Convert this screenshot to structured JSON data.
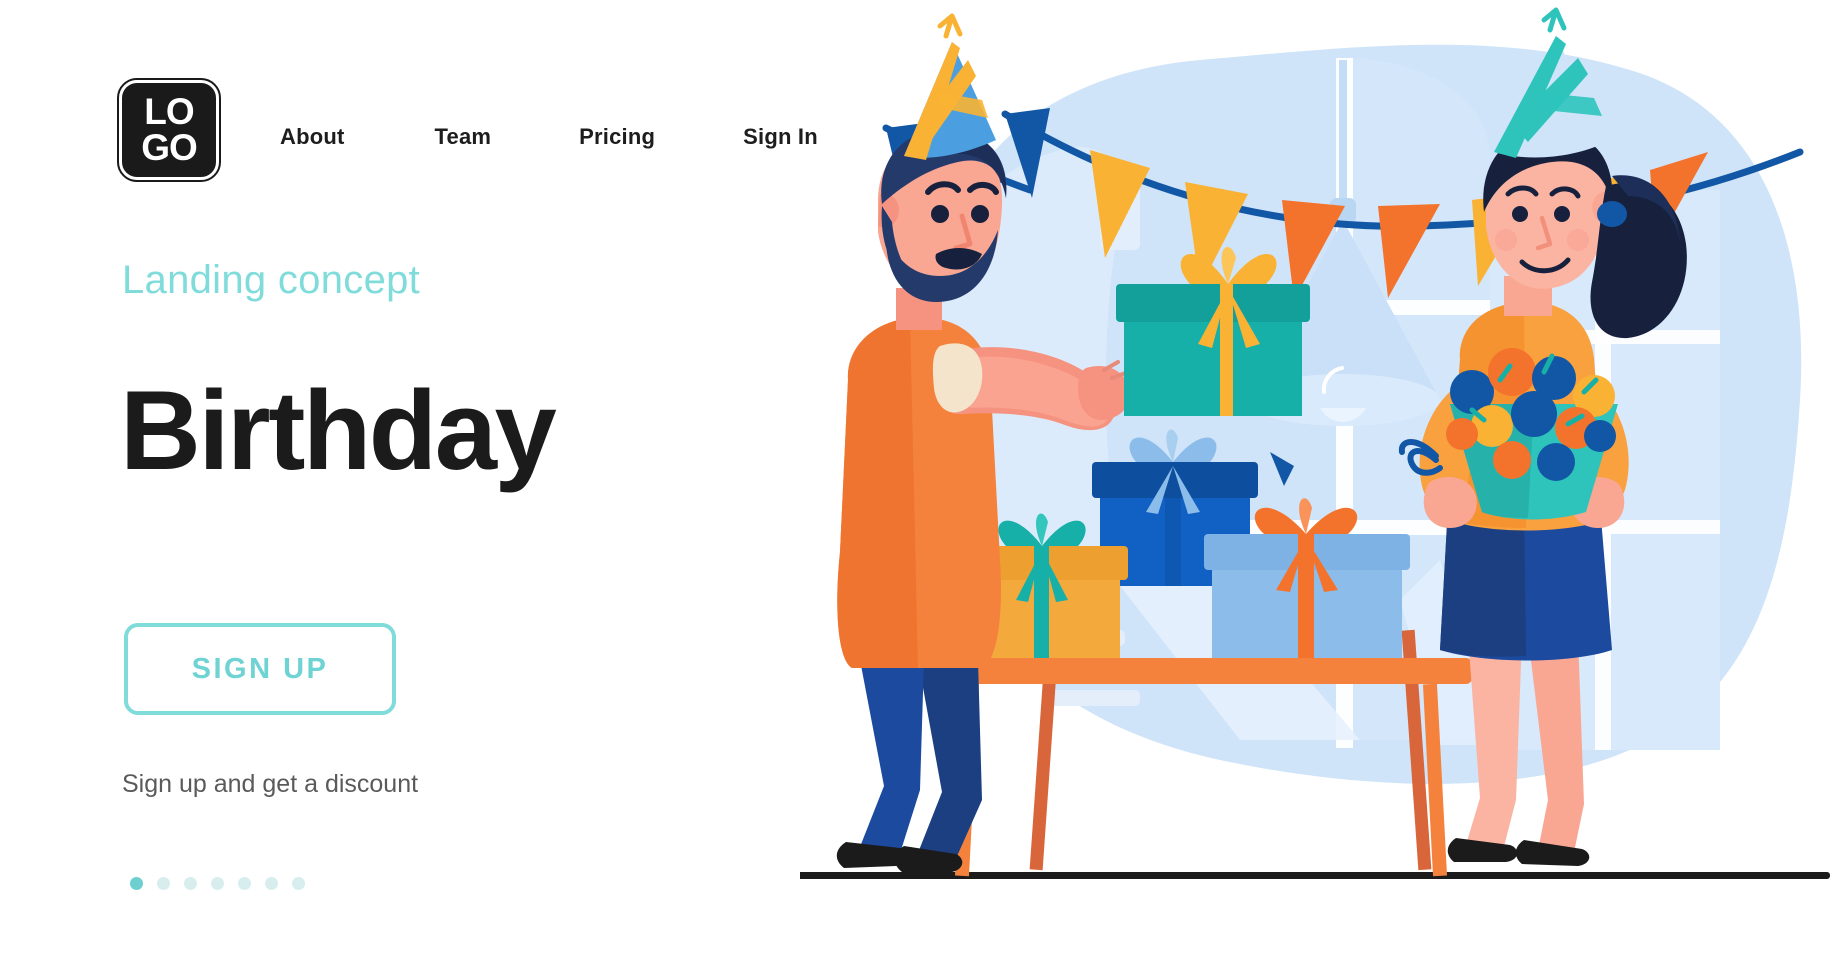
{
  "header": {
    "logo": {
      "line1": "LO",
      "line2": "GO",
      "name": "logo"
    },
    "nav": [
      {
        "label": "About"
      },
      {
        "label": "Team"
      },
      {
        "label": "Pricing"
      },
      {
        "label": "Sign In"
      }
    ],
    "menu_icon": "three-dots-icon"
  },
  "hero": {
    "eyebrow": "Landing concept",
    "headline": "Birthday",
    "cta_label": "SIGN UP",
    "subtext": "Sign up and get a discount",
    "pager": {
      "count": 7,
      "active_index": 0
    }
  },
  "colors": {
    "accent_teal": "#7fdcdb",
    "accent_teal_dark": "#6dcfcf",
    "text_dark": "#1b1b1b",
    "text_muted": "#5a5a5a",
    "orange": "#f47b36",
    "orange_light": "#f9a03f",
    "blue_dark": "#0d4f9e",
    "blue_mid": "#1565c0",
    "blue_light": "#8cbdea",
    "bg_blob": "#cfe4f8",
    "bg_blob_light": "#dcebfb",
    "teal_gift": "#17b0a8",
    "yellow": "#f9b233",
    "skin": "#f59380",
    "hair_dark": "#243a6b"
  },
  "illustration": {
    "name": "birthday-party-illustration",
    "scene_elements": [
      "background-blob",
      "window-frame",
      "pendant-lamp",
      "bunting-flags",
      "man-with-gift",
      "woman-with-flowers",
      "table-with-gifts",
      "floor-line"
    ]
  }
}
